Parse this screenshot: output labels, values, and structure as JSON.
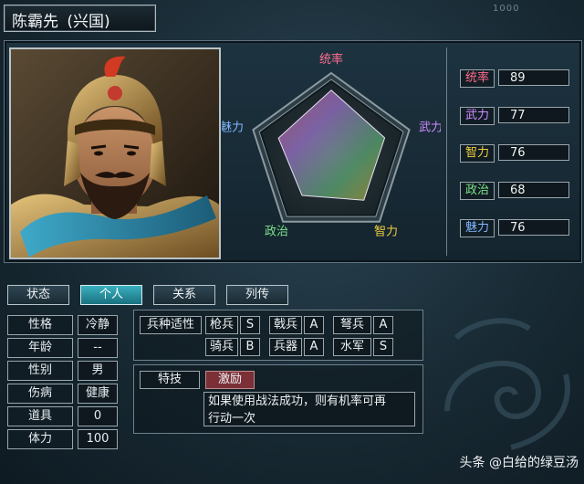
{
  "header": {
    "name": "陈霸先",
    "faction": "(兴国)",
    "deco_counter": "1000"
  },
  "radar": {
    "labels": {
      "leadership": "统率",
      "war": "武力",
      "intelligence": "智力",
      "politics": "政治",
      "charm": "魅力"
    },
    "values": {
      "leadership": 89,
      "war": 77,
      "intelligence": 76,
      "politics": 68,
      "charm": 76
    },
    "label_colors": {
      "leadership": "#ff6f8f",
      "war": "#d18cff",
      "intelligence": "#f0d040",
      "politics": "#7fe28a",
      "charm": "#7fb8ff"
    }
  },
  "stats": [
    {
      "label": "统率",
      "value": "89",
      "color": "#ff6f8f"
    },
    {
      "label": "武力",
      "value": "77",
      "color": "#d18cff"
    },
    {
      "label": "智力",
      "value": "76",
      "color": "#f0d040"
    },
    {
      "label": "政治",
      "value": "68",
      "color": "#7fe28a"
    },
    {
      "label": "魅力",
      "value": "76",
      "color": "#7fb8ff"
    }
  ],
  "tabs": [
    {
      "label": "状态",
      "active": false
    },
    {
      "label": "个人",
      "active": true
    },
    {
      "label": "关系",
      "active": false
    },
    {
      "label": "列传",
      "active": false
    }
  ],
  "personal": [
    {
      "label": "性格",
      "value": "冷静"
    },
    {
      "label": "年龄",
      "value": "--"
    },
    {
      "label": "性别",
      "value": "男"
    },
    {
      "label": "伤病",
      "value": "健康"
    },
    {
      "label": "道具",
      "value": "0"
    },
    {
      "label": "体力",
      "value": "100"
    }
  ],
  "aptitude": {
    "title": "兵种适性",
    "rows": [
      [
        {
          "unit": "枪兵",
          "grade": "S"
        },
        {
          "unit": "戟兵",
          "grade": "A"
        },
        {
          "unit": "弩兵",
          "grade": "A"
        }
      ],
      [
        {
          "unit": "骑兵",
          "grade": "B"
        },
        {
          "unit": "兵器",
          "grade": "A"
        },
        {
          "unit": "水军",
          "grade": "S"
        }
      ]
    ]
  },
  "skill": {
    "title": "特技",
    "name": "激励",
    "desc_line1": "如果使用战法成功，则有机率可再",
    "desc_line2": "行动一次"
  },
  "watermark": "头条 @白给的绿豆汤",
  "colors": {
    "accent_tab": "#2aa0b0",
    "skill_name_bg": "#7a3036"
  }
}
